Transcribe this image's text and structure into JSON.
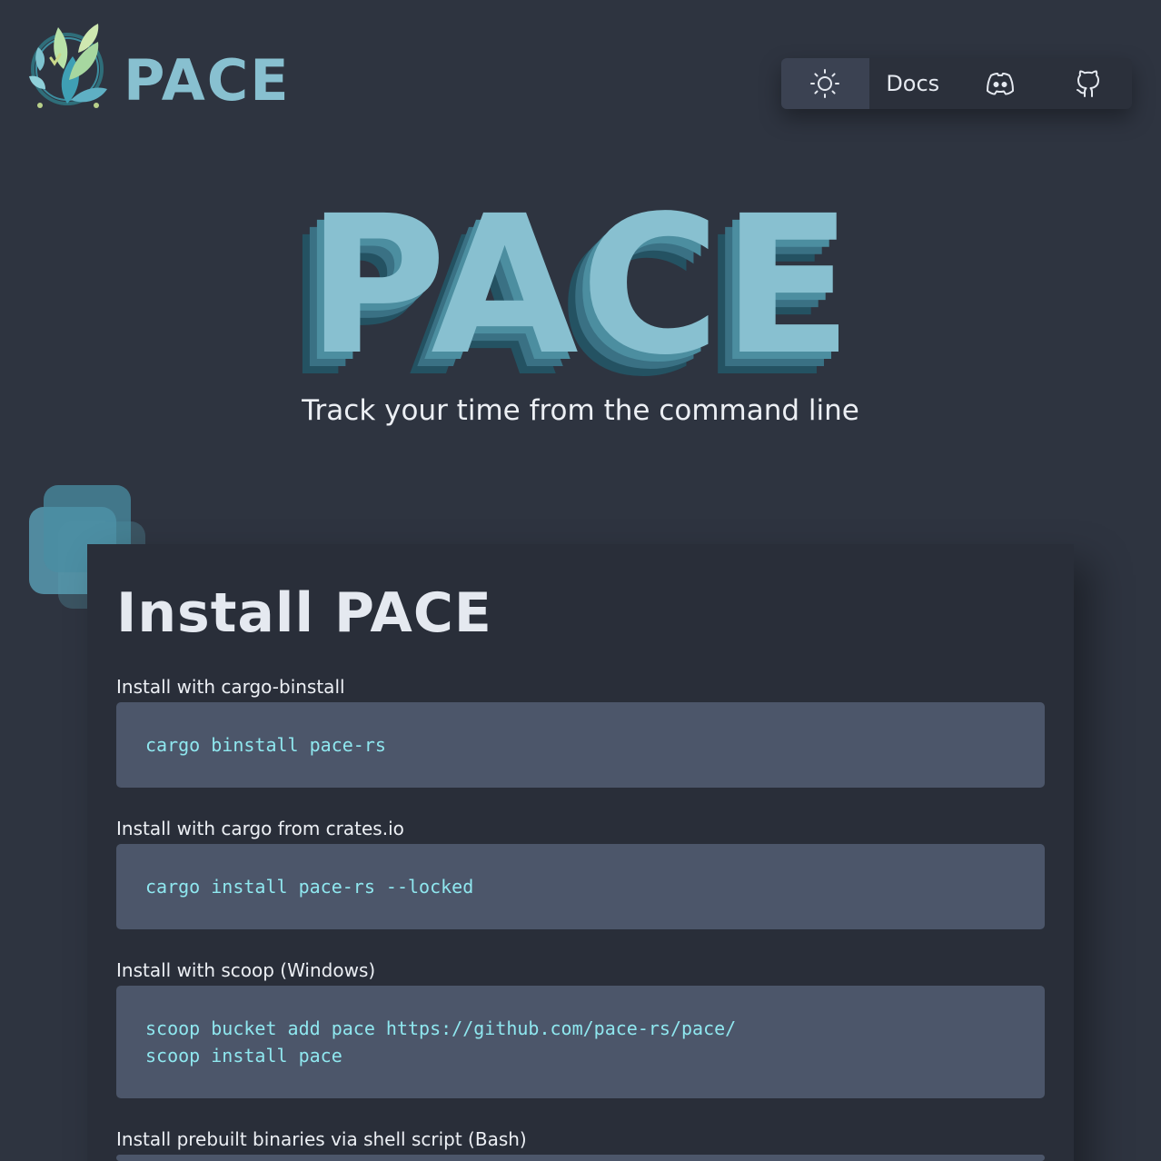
{
  "header": {
    "logo_text": "PACE",
    "nav": [
      {
        "icon": "sun-icon"
      },
      {
        "label": "Docs"
      },
      {
        "icon": "discord-icon"
      },
      {
        "icon": "github-icon"
      }
    ]
  },
  "hero": {
    "title": "PACE",
    "subtitle": "Track your time from the command line"
  },
  "install": {
    "title": "Install PACE",
    "methods": [
      {
        "label": "Install with cargo-binstall",
        "lines": [
          "cargo binstall pace-rs"
        ]
      },
      {
        "label": "Install with cargo from crates.io",
        "lines": [
          "cargo install pace-rs --locked"
        ]
      },
      {
        "label": "Install with scoop (Windows)",
        "lines": [
          "scoop bucket add pace https://github.com/pace-rs/pace/",
          "scoop install pace"
        ]
      },
      {
        "label": "Install prebuilt binaries via shell script (Bash)",
        "lines": []
      }
    ]
  },
  "colors": {
    "background": "#2e3440",
    "accent": "#88c0d0",
    "code_text": "#8fe7ef",
    "code_bg": "#4c566a",
    "card_bg": "#292e39"
  }
}
